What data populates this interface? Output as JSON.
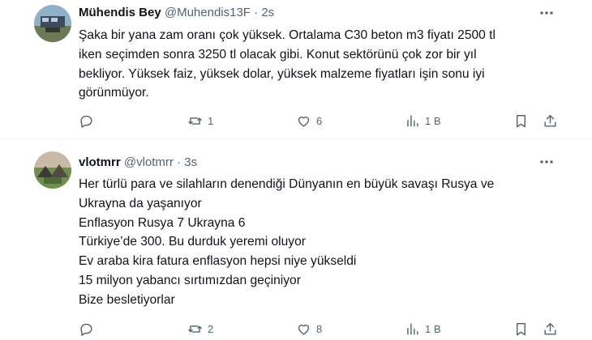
{
  "tweets": [
    {
      "display_name": "Mühendis Bey",
      "handle": "@Muhendis13F",
      "separator": "·",
      "time": "2s",
      "lines": [
        "Şaka bir yana zam oranı çok yüksek. Ortalama C30 beton m3 fiyatı 2500 tl",
        "iken seçimden sonra 3250 tl olacak gibi. Konut sektörünü çok zor bir yıl",
        "bekliyor. Yüksek faiz, yüksek dolar, yüksek malzeme fiyatları işin sonu iyi",
        "görünmüyor."
      ],
      "reply_count": "",
      "retweet_count": "1",
      "like_count": "6",
      "view_count": "1 B"
    },
    {
      "display_name": "vlotmrr",
      "handle": "@vlotmrr",
      "separator": "·",
      "time": "3s",
      "lines": [
        "Her türlü para ve silahların denendiği Dünyanın en büyük savaşı Rusya ve",
        "Ukrayna da yaşanıyor",
        "Enflasyon Rusya 7 Ukrayna 6",
        "Türkiye’de 300. Bu durduk yeremi oluyor",
        "Ev araba kira fatura enflasyon hepsi niye yükseldi",
        "15 milyon yabancı sırtımızdan geçiniyor",
        "Bize besletiyorlar"
      ],
      "reply_count": "",
      "retweet_count": "2",
      "like_count": "8",
      "view_count": "1 B"
    }
  ],
  "icons": {
    "more": "more-horizontal-icon",
    "reply": "reply-icon",
    "retweet": "retweet-icon",
    "like": "heart-icon",
    "views": "views-chart-icon",
    "bookmark": "bookmark-icon",
    "share": "share-icon"
  },
  "colors": {
    "text": "#0f1419",
    "secondary": "#536471",
    "divider": "#eff3f4"
  }
}
